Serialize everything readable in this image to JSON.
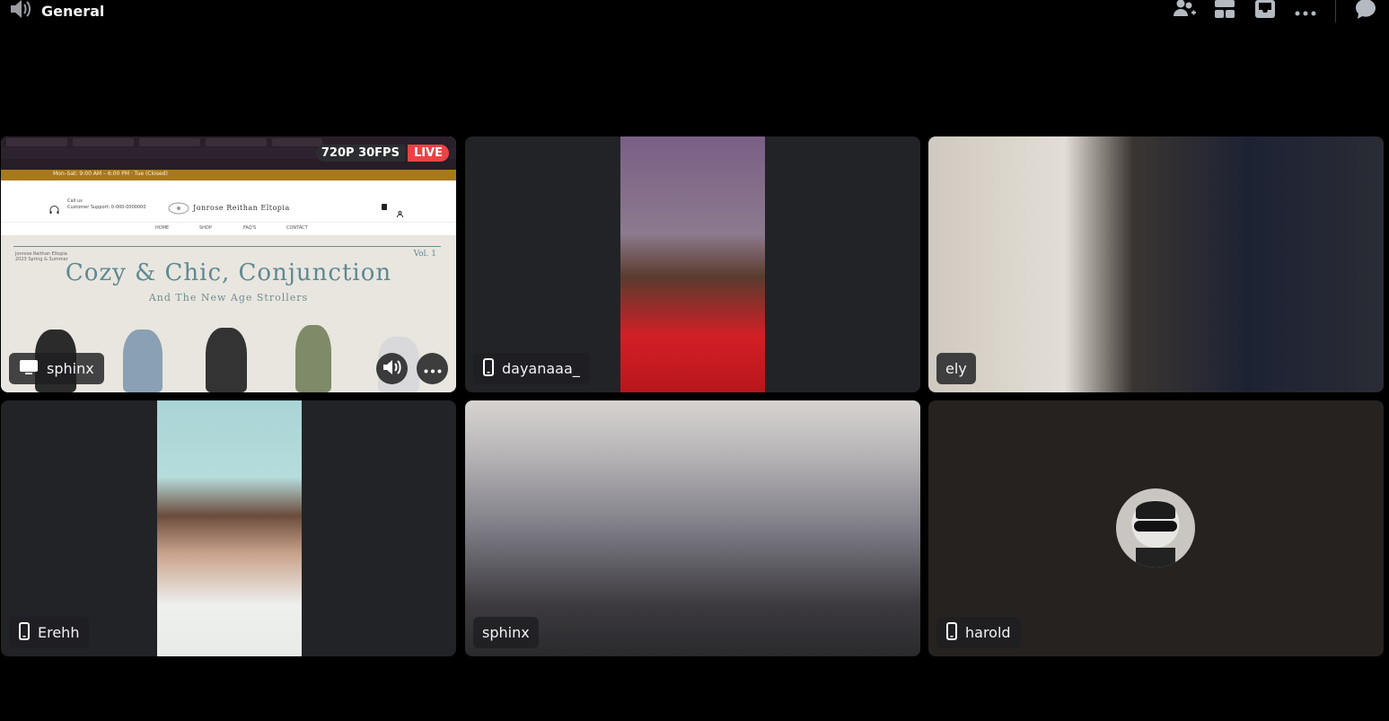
{
  "header": {
    "channel_icon": "speaker-icon",
    "channel_name": "General",
    "actions": [
      {
        "name": "add-people-button",
        "icon": "person-plus-icon"
      },
      {
        "name": "grid-layout-button",
        "icon": "grid-icon"
      },
      {
        "name": "inbox-button",
        "icon": "inbox-icon"
      },
      {
        "name": "more-options-button",
        "icon": "ellipsis-icon"
      },
      {
        "name": "chat-button",
        "icon": "chat-bubble-icon"
      }
    ]
  },
  "tiles": [
    {
      "user": "sphinx",
      "device": "screen",
      "device_icon": "screen-share-icon",
      "stream": {
        "quality": "720P 30FPS",
        "status": "LIVE"
      }
    },
    {
      "user": "dayanaaa_",
      "device": "mobile",
      "device_icon": "phone-icon"
    },
    {
      "user": "ely",
      "device": "",
      "device_icon": ""
    },
    {
      "user": "Erehh",
      "device": "mobile",
      "device_icon": "phone-icon"
    },
    {
      "user": "sphinx",
      "device": "",
      "device_icon": ""
    },
    {
      "user": "harold",
      "device": "mobile",
      "device_icon": "phone-icon"
    }
  ],
  "screenshare_content": {
    "banner": "Mon–Sat: 9:00 AM – 6:00 PM · Tue (Closed)",
    "brand": "Jonrose Reithan Eltopia",
    "support": "Call us\nCustomer Support: 0-000-0000000",
    "nav": [
      "HOME",
      "SHOP",
      "FAQ'S",
      "CONTACT"
    ],
    "hero_label": "Jonrose Reithan Eltopia\n2023 Spring & Summer",
    "hero_title": "Cozy & Chic, Conjunction",
    "hero_subtitle": "And The New Age Strollers",
    "volume": "Vol. 1"
  },
  "colors": {
    "background": "#000000",
    "tile": "#1e1f22",
    "live": "#ed4245",
    "nameplate": "#1e1f22"
  }
}
